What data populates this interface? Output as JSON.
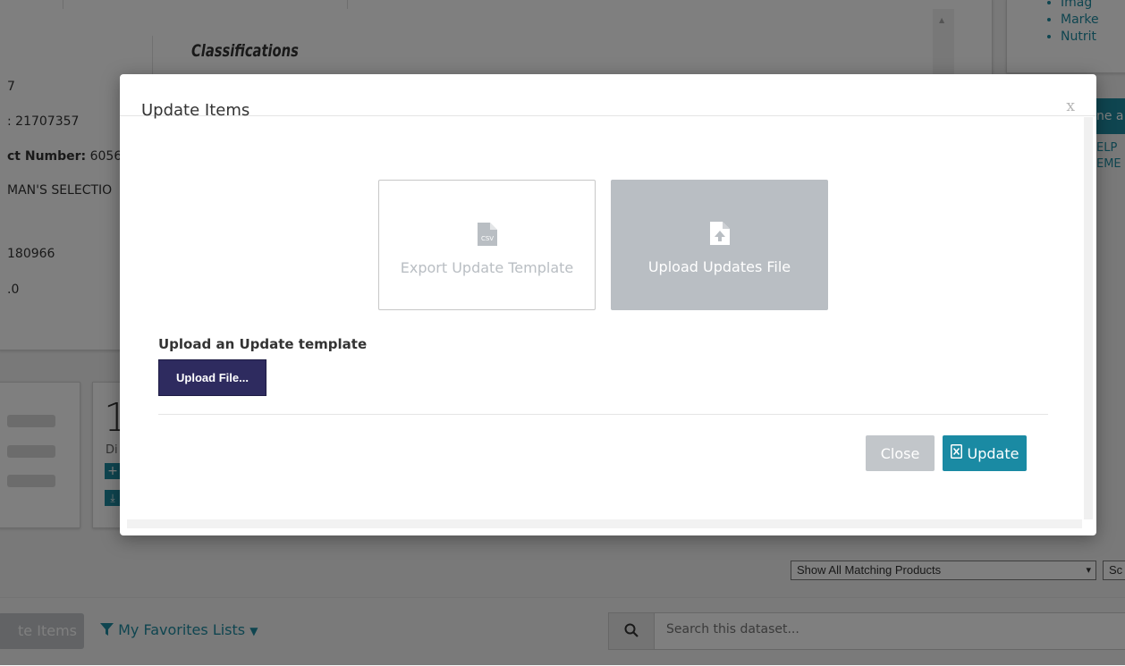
{
  "background": {
    "classifications_title": "Classifications",
    "fields": [
      "7",
      ": 21707357",
      "ct Number: 6056",
      "MAN'S SELECTIO",
      "180966",
      ".0"
    ],
    "field_bold_label": "ct Number:",
    "field_bold_value": " 6056",
    "side_links": [
      "Imag",
      "Marke",
      "Nutrit"
    ],
    "side_button_label": "ne a",
    "side_text_1": "ELP",
    "side_text_2": "EME",
    "stat_big_number": "1",
    "stat_small_label": "Di",
    "select_value": "Show All Matching Products",
    "select_partial": "Sc",
    "update_items_btn": "te Items",
    "favorites_label": "My Favorites Lists",
    "search_placeholder": "Search this dataset..."
  },
  "modal": {
    "title": "Update Items",
    "close_glyph": "x",
    "tiles": {
      "export_label": "Export Update Template",
      "export_icon_text": "CSV",
      "upload_label": "Upload Updates File"
    },
    "upload_heading": "Upload an Update template",
    "upload_button": "Upload File...",
    "close_button": "Close",
    "update_button": "Update"
  },
  "colors": {
    "accent": "#1a8aa3",
    "upload_file_btn": "#2e2b5f",
    "tile_disabled": "#b9bec3"
  }
}
